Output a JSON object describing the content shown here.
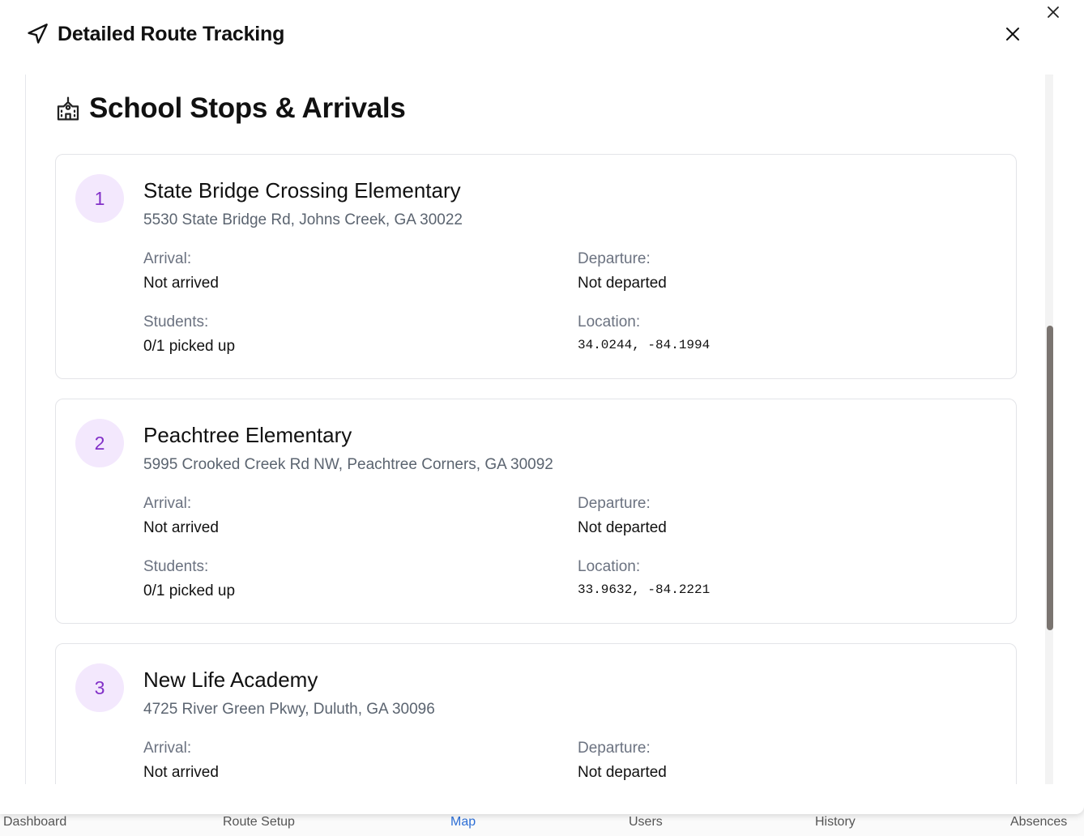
{
  "bottom_nav": [
    "Dashboard",
    "Route Setup",
    "Map",
    "Users",
    "History",
    "Absences"
  ],
  "modal": {
    "title": "Detailed Route Tracking",
    "section_title": "School Stops & Arrivals",
    "labels": {
      "arrival": "Arrival:",
      "departure": "Departure:",
      "students": "Students:",
      "location": "Location:"
    },
    "stops": [
      {
        "number": "1",
        "name": "State Bridge Crossing Elementary",
        "address": "5530 State Bridge Rd, Johns Creek, GA 30022",
        "arrival": "Not arrived",
        "departure": "Not departed",
        "students": "0/1 picked up",
        "location": "34.0244, -84.1994"
      },
      {
        "number": "2",
        "name": "Peachtree Elementary",
        "address": "5995 Crooked Creek Rd NW, Peachtree Corners, GA 30092",
        "arrival": "Not arrived",
        "departure": "Not departed",
        "students": "0/1 picked up",
        "location": "33.9632, -84.2221"
      },
      {
        "number": "3",
        "name": "New Life Academy",
        "address": "4725 River Green Pkwy, Duluth, GA 30096",
        "arrival": "Not arrived",
        "departure": "Not departed"
      }
    ]
  },
  "colors": {
    "badge_bg": "#f3e8fd",
    "badge_text": "#8230c8",
    "active_nav": "#2d6fd6"
  }
}
